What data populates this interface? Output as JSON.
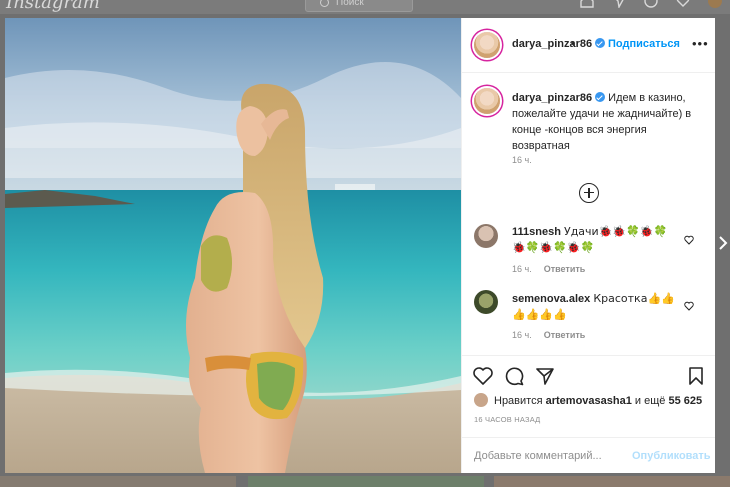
{
  "topbar": {
    "logo": "Instagram",
    "search_placeholder": "Поиск"
  },
  "post": {
    "author": "darya_pinzar86",
    "separator": "•",
    "follow_label": "Подписаться",
    "more_label": "•••",
    "caption_user": "darya_pinzar86",
    "caption_text": "Идем в казино, пожелайте удачи не жадничайте) в конце -концов вся энергия возвратная",
    "caption_time": "16 ч.",
    "likes_prefix": "Нравится",
    "likes_user": "artemovasasha1",
    "likes_and": "и ещё",
    "likes_count": "55 625",
    "posted_ago": "16 ЧАСОВ НАЗАД",
    "comment_placeholder": "Добавьте комментарий...",
    "publish_label": "Опубликовать"
  },
  "comments": [
    {
      "user": "111snesh",
      "text": "Удачи🐞🐞🍀🐞🍀🐞🍀🐞🍀🐞🍀",
      "time": "16 ч.",
      "reply": "Ответить"
    },
    {
      "user": "semenova.alex",
      "text": "Красотка👍👍👍👍👍👍",
      "time": "16 ч.",
      "reply": "Ответить"
    }
  ],
  "colors": {
    "accent": "#0095f6",
    "verified": "#3897f0",
    "text": "#262626",
    "muted": "#8e8e8e",
    "overlay": "#6f6f6f"
  }
}
